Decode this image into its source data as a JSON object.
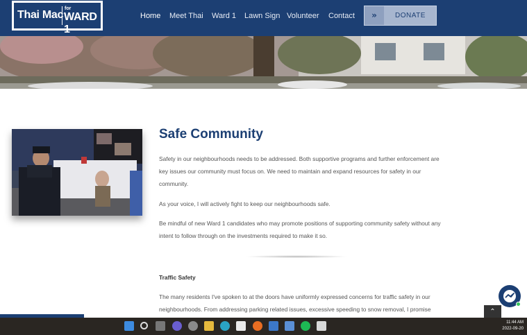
{
  "header": {
    "logo": {
      "name": "Thai Mac",
      "for": "for",
      "ward": "WARD 1"
    },
    "nav": [
      {
        "label": "Home",
        "active": true
      },
      {
        "label": "Meet Thai",
        "active": false
      },
      {
        "label": "Ward 1",
        "active": false
      },
      {
        "label": "Lawn Sign",
        "active": false
      },
      {
        "label": "Volunteer",
        "active": false
      },
      {
        "label": "Contact",
        "active": false
      }
    ],
    "donate": {
      "icon": "double-chevron-right-icon",
      "label": "DONATE"
    }
  },
  "main": {
    "title": "Safe Community",
    "paragraphs": [
      "Safety in our neighbourhoods needs to be addressed. Both supportive programs and further enforcement are key issues our community must focus on. We need to maintain and expand resources for safety in our community.",
      "As your voice, I will actively fight to keep our neighbourhoods safe.",
      "Be mindful of new Ward 1 candidates who may promote positions of supporting community safety without any intent to follow through on the investments required to make it so."
    ],
    "subheading": "Traffic Safety",
    "traffic_paragraph": "The many residents I've spoken to at the doors have uniformly expressed concerns for traffic safety in our neighbourhoods. From addressing parking related issues, excessive speeding to snow removal, I promise"
  },
  "floating": {
    "messenger_icon": "messenger-icon",
    "scroll_top_icon": "chevron-up-icon"
  },
  "taskbar": {
    "time": "11:44 AM",
    "date": "2022-09-20",
    "icons": [
      "windows-start-icon",
      "search-icon",
      "task-view-icon",
      "chat-icon",
      "settings-icon",
      "file-explorer-icon",
      "edge-icon",
      "store-icon",
      "firefox-icon",
      "notepad-icon",
      "spotify-icon",
      "snipping-tool-icon"
    ]
  },
  "colors": {
    "brand": "#1c3f73",
    "donate_bg": "#a7b6cf"
  }
}
